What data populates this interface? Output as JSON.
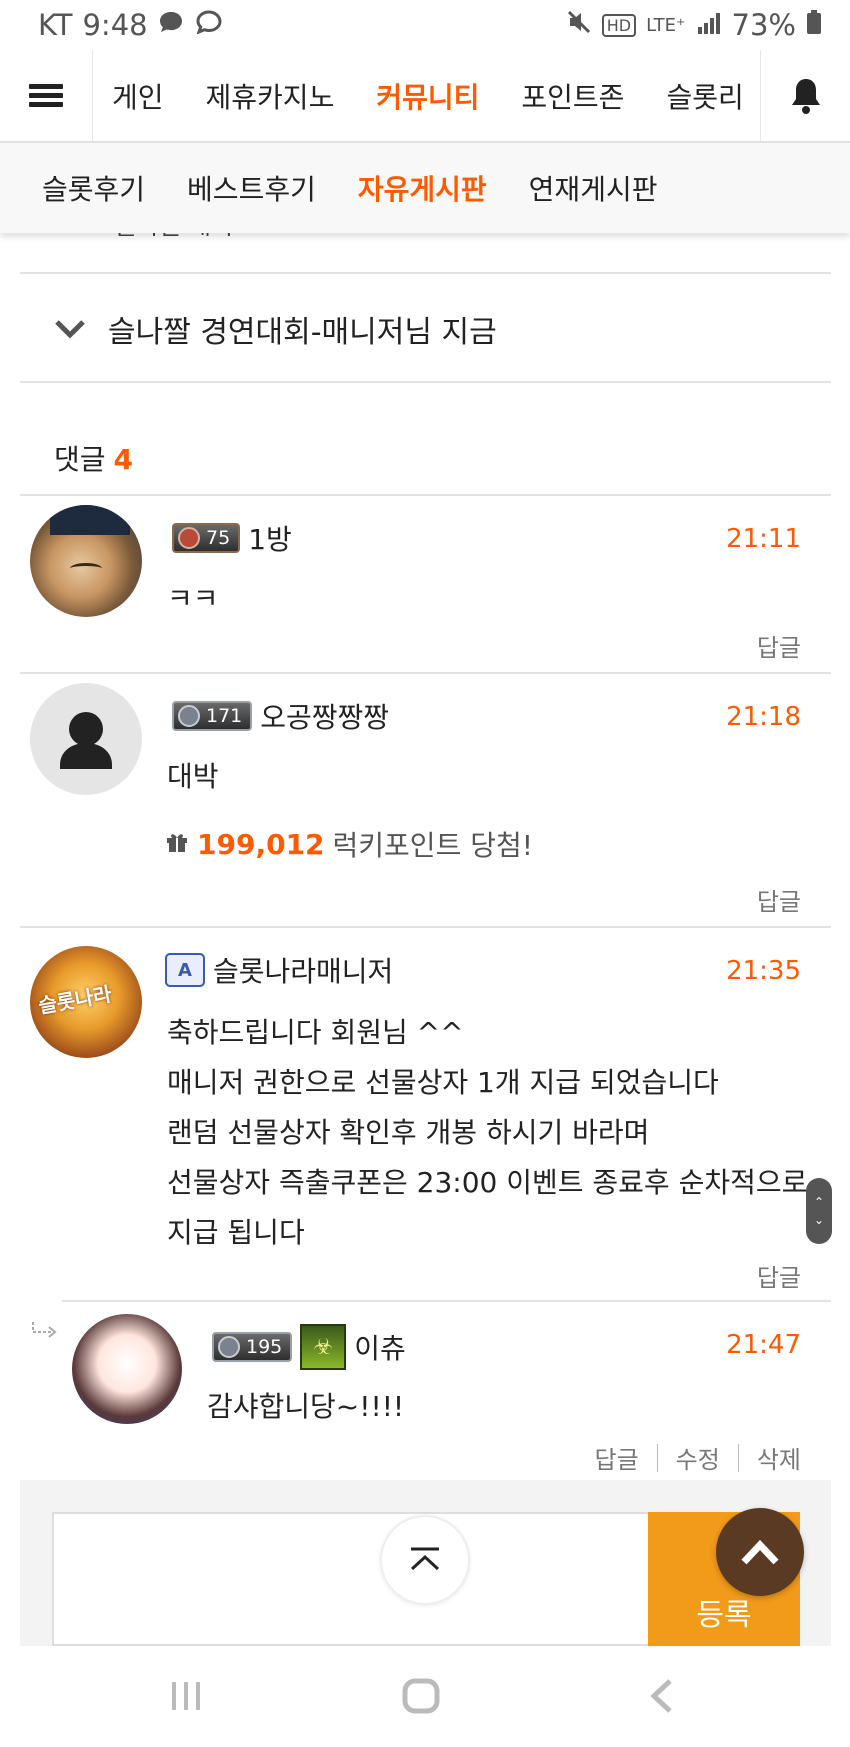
{
  "status_bar": {
    "carrier": "KT",
    "time": "9:48",
    "network": "LTE⁺",
    "hd": "HD",
    "battery": "73%"
  },
  "top_nav": {
    "items": [
      "게인",
      "제휴카지노",
      "커뮤니티",
      "포인트존",
      "슬롯리"
    ],
    "active_index": 2
  },
  "sub_tabs": {
    "items": [
      "슬롯후기",
      "베스트후기",
      "자유게시판",
      "연재게시판"
    ],
    "active_index": 2
  },
  "partial_title": "슬나짤 대회",
  "post": {
    "title": "슬나짤 경연대회-매니저님 지금"
  },
  "comments_header": {
    "label": "댓글",
    "count": "4"
  },
  "comments": [
    {
      "level": "75",
      "username": "1방",
      "time": "21:11",
      "body": "ㅋㅋ",
      "reply_label": "답글"
    },
    {
      "level": "171",
      "username": "오공짱짱짱",
      "time": "21:18",
      "body": "대박",
      "reward_amount": "199,012",
      "reward_text": "럭키포인트 당첨!",
      "reply_label": "답글"
    },
    {
      "admin_badge": "A",
      "username": "슬롯나라매니저",
      "time": "21:35",
      "body_lines": [
        "축하드립니다 회원님 ^^",
        "매니저 권한으로 선물상자 1개 지급 되었습니다",
        "랜덤 선물상자 확인후 개봉 하시기 바라며",
        "선물상자 즉출쿠폰은 23:00 이벤트 종료후 순차적으로",
        "지급 됩니다"
      ],
      "reply_label": "답글"
    },
    {
      "level": "195",
      "username": "이츄",
      "time": "21:47",
      "body": "감샤합니당~!!!!",
      "actions": [
        "답글",
        "수정",
        "삭제"
      ]
    }
  ],
  "input": {
    "submit_label": "등록"
  },
  "colors": {
    "accent": "#ff5a00",
    "submit": "#f29a1a",
    "fab": "#5a3a22"
  }
}
